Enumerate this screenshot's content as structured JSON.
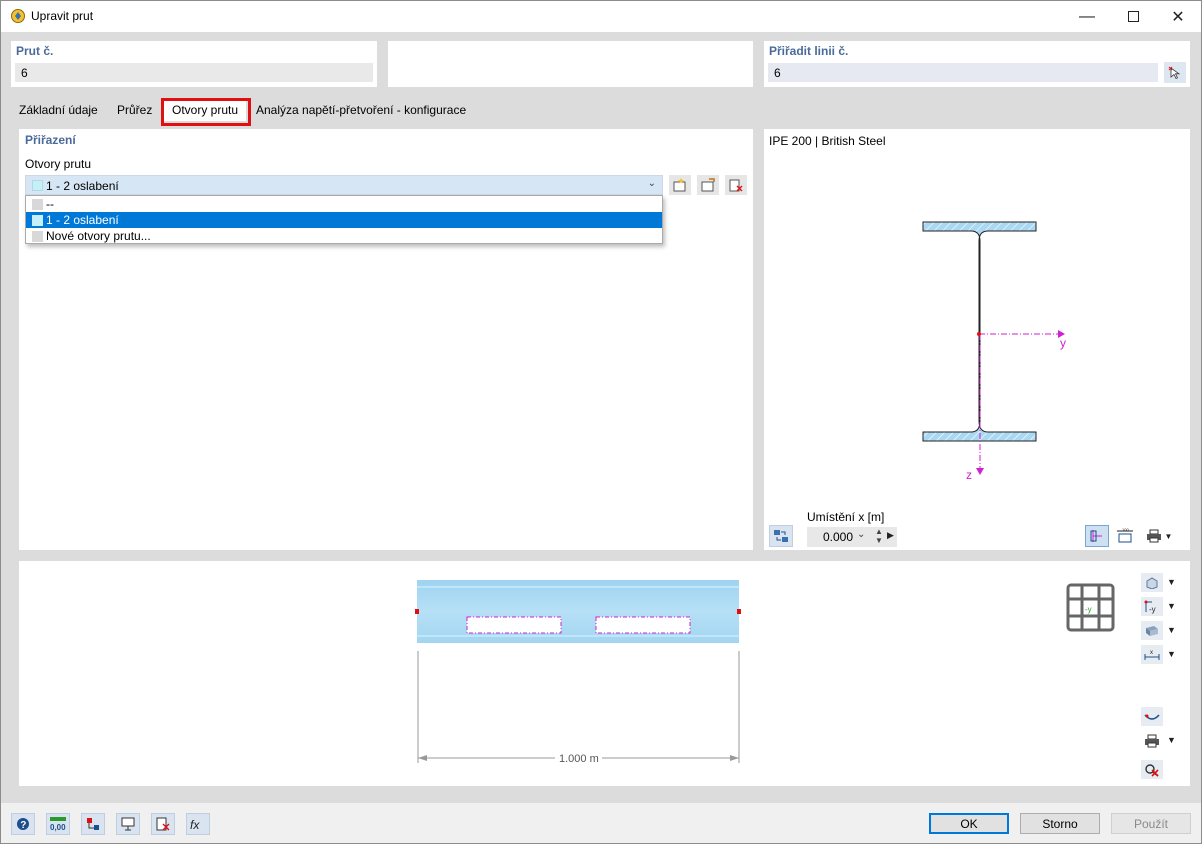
{
  "window": {
    "title": "Upravit prut"
  },
  "member_no": {
    "label": "Prut č.",
    "value": "6"
  },
  "assign_line": {
    "label": "Přiřadit linii č.",
    "value": "6"
  },
  "tabs": [
    {
      "label": "Základní údaje"
    },
    {
      "label": "Průřez"
    },
    {
      "label": "Otvory prutu"
    },
    {
      "label": "Analýza napětí-přetvoření - konfigurace"
    }
  ],
  "assignment": {
    "section_label": "Přiřazení",
    "field_label": "Otvory prutu",
    "selected": "1 - 2 oslabení",
    "options": [
      "--",
      "1 - 2 oslabení",
      "Nové otvory prutu..."
    ]
  },
  "section_preview": {
    "title": "IPE 200 | British Steel",
    "axis_y": "y",
    "axis_z": "z",
    "position_label": "Umístění x [m]",
    "position_value": "0.000"
  },
  "member_view": {
    "dimension": "1.000 m",
    "nav_label": "-y"
  },
  "footer": {
    "ok": "OK",
    "cancel": "Storno",
    "apply": "Použít"
  },
  "colors": {
    "beam": "#a9d8f2",
    "opening_outline": "#d020d0",
    "highlight_red": "#e01010",
    "selection": "#0078d7"
  }
}
